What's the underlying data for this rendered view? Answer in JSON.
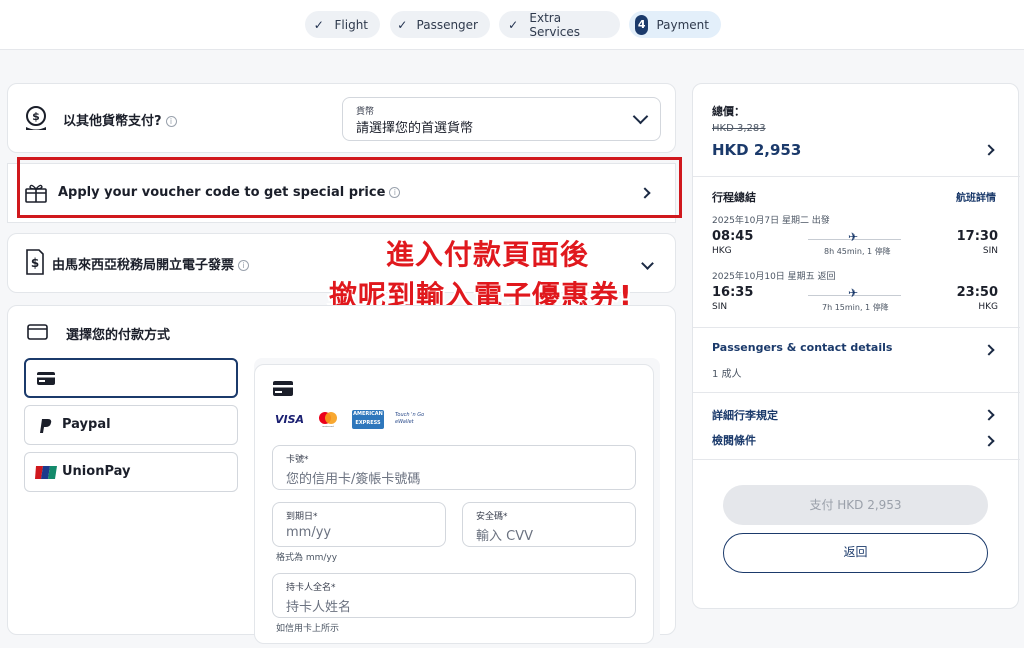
{
  "steps": [
    {
      "label": "Flight"
    },
    {
      "label": "Passenger"
    },
    {
      "label": "Extra Services"
    },
    {
      "label": "Payment",
      "number": "4"
    }
  ],
  "currency": {
    "title": "以其他貨幣支付?",
    "select_label": "貨幣",
    "select_value": "請選擇您的首選貨幣"
  },
  "voucher": {
    "label": "Apply your voucher code to get special price"
  },
  "einvoice": {
    "label": "由馬來西亞稅務局開立電子發票"
  },
  "annotation": {
    "line1": "進入付款頁面後",
    "line2": "撳呢到輸入電子優惠券!"
  },
  "payment": {
    "title": "選擇您的付款方式",
    "methods": [
      {
        "label": ""
      },
      {
        "label": "Paypal"
      },
      {
        "label": "UnionPay"
      }
    ],
    "card_brands": [
      "VISA",
      "mastercard",
      "AMERICAN EXPRESS",
      "Touch 'n Go eWallet"
    ],
    "card_number_label": "卡號*",
    "card_number_placeholder": "您的信用卡/簽帳卡號碼",
    "expiry_label": "到期日*",
    "expiry_placeholder": "mm/yy",
    "expiry_hint": "格式為 mm/yy",
    "cvv_label": "安全碼*",
    "cvv_placeholder": "輸入 CVV",
    "holder_label": "持卡人全名*",
    "holder_placeholder": "持卡人姓名",
    "holder_hint": "如信用卡上所示"
  },
  "summary": {
    "total_label": "總價：",
    "original_price": "HKD 3,283",
    "price": "HKD 2,953",
    "itinerary_label": "行程總結",
    "flight_details_link": "航班詳情",
    "outbound": {
      "date": "2025年10月7日 星期二 出發",
      "dep_time": "08:45",
      "dep_code": "HKG",
      "duration": "8h 45min, 1 停降",
      "arr_time": "17:30",
      "arr_code": "SIN"
    },
    "inbound": {
      "date": "2025年10月10日 星期五 返回",
      "dep_time": "16:35",
      "dep_code": "SIN",
      "duration": "7h 15min, 1 停降",
      "arr_time": "23:50",
      "arr_code": "HKG"
    },
    "passengers_label": "Passengers & contact details",
    "passengers_value": "1 成人",
    "baggage_label": "詳細行李規定",
    "terms_label": "檢閱條件",
    "pay_button": "支付 HKD 2,953",
    "back_button": "返回"
  },
  "colors": {
    "accent": "#1b3a6b",
    "highlight_box": "#d0181d"
  }
}
